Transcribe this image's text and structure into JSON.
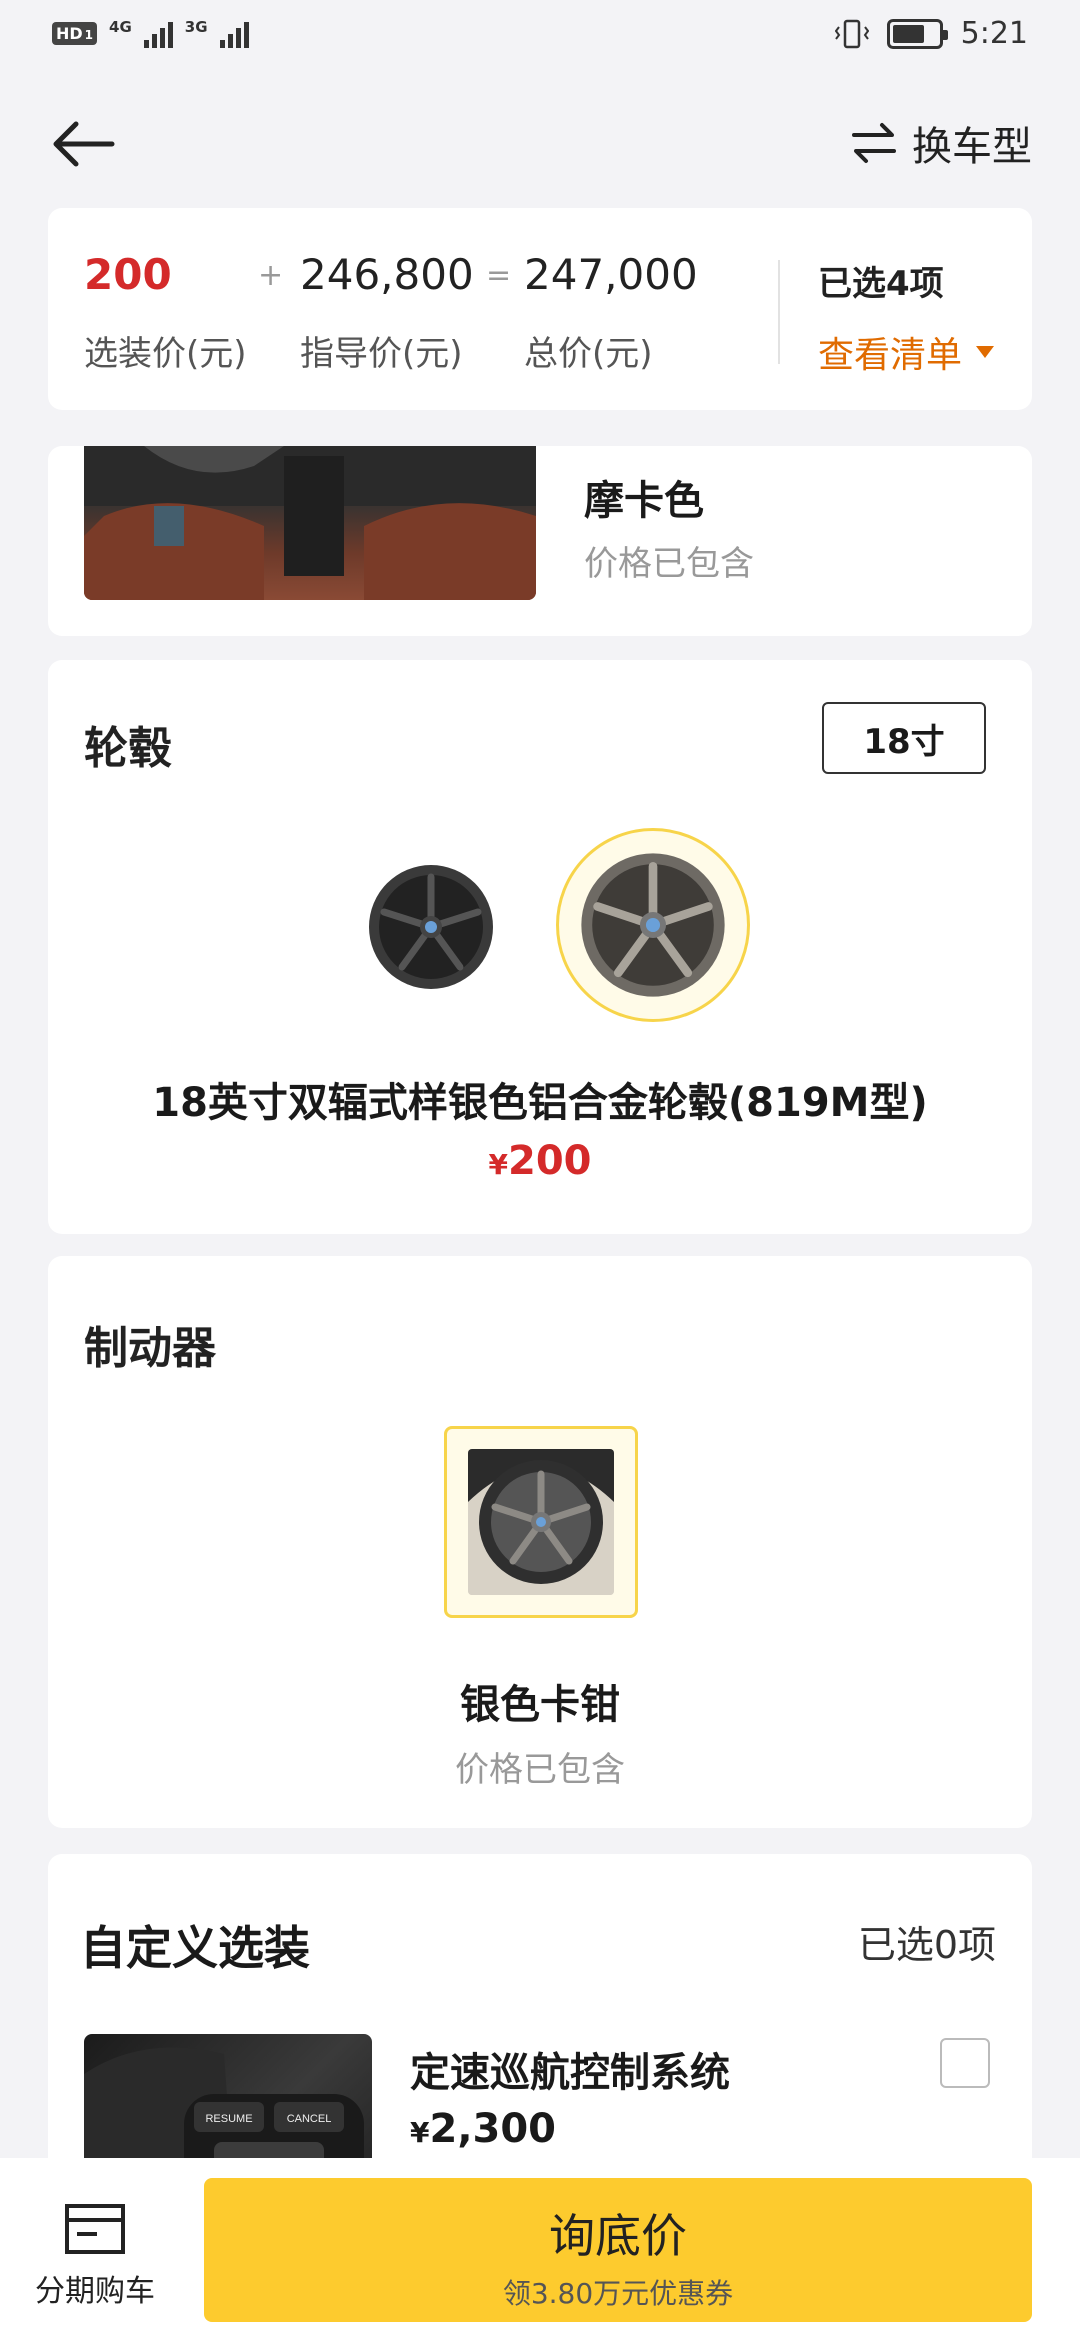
{
  "status": {
    "time": "5:21",
    "net1": "4G",
    "net2": "3G",
    "hd": "HD",
    "sim": "1",
    "battery_level": 0.72
  },
  "nav": {
    "switch_label": "换车型"
  },
  "price": {
    "option_price": "200",
    "option_label": "选装价(元)",
    "plus": "+",
    "guide_price": "246,800",
    "guide_label": "指导价(元)",
    "equals": "=",
    "total_price": "247,000",
    "total_label": "总价(元)",
    "selected": "已选4项",
    "view_list": "查看清单"
  },
  "interior": {
    "name": "摩卡色",
    "price": "价格已包含"
  },
  "wheel": {
    "title": "轮毂",
    "size": "18寸",
    "name": "18英寸双辐式样银色铝合金轮毂(819M型)",
    "currency": "¥",
    "price": "200"
  },
  "brake": {
    "title": "制动器",
    "name": "银色卡钳",
    "price": "价格已包含"
  },
  "custom": {
    "title": "自定义选装",
    "count": "已选0项",
    "item": {
      "name": "定速巡航控制系统",
      "currency": "¥",
      "price": "2,300",
      "btn1": "RESUME",
      "btn2": "CANCEL"
    }
  },
  "bottom": {
    "installment": "分期购车",
    "cta_main": "询底价",
    "cta_sub": "领3.80万元优惠券"
  },
  "colors": {
    "accent": "#fdcb2e",
    "price_red": "#d42a2a",
    "orange": "#e06b00"
  }
}
